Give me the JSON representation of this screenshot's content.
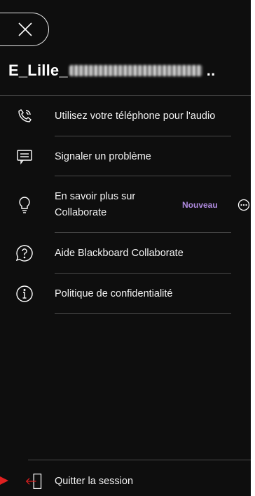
{
  "panel": {
    "session_title_prefix": "E_Lille_",
    "session_title_suffix": ".."
  },
  "menu": {
    "items": [
      {
        "label": "Utilisez votre téléphone pour l'audio",
        "icon": "phone-audio-icon"
      },
      {
        "label": "Signaler un problème",
        "icon": "report-problem-icon"
      },
      {
        "label_line1": "En savoir plus sur",
        "label_line2": "Collaborate",
        "icon": "lightbulb-icon",
        "badge": "Nouveau"
      },
      {
        "label": "Aide Blackboard Collaborate",
        "icon": "help-question-icon"
      },
      {
        "label": "Politique de confidentialité",
        "icon": "info-icon"
      }
    ]
  },
  "footer": {
    "leave_label": "Quitter la session",
    "icon": "leave-session-icon"
  },
  "colors": {
    "panel_bg": "#0e0e0e",
    "badge": "#b08be0",
    "pointer": "#e02020"
  }
}
